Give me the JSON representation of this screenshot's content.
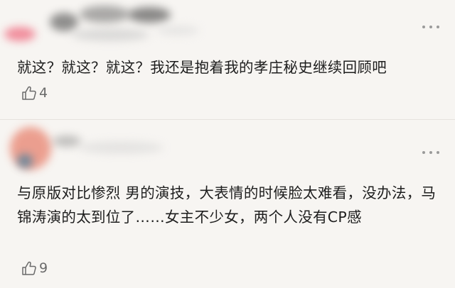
{
  "comments": [
    {
      "text": "就这？就这？就这？我还是抱着我的孝庄秘史继续回顾吧",
      "likes": "4",
      "like_icon": "thumbs-up-icon",
      "more_icon": "more-dots-icon"
    },
    {
      "text": "与原版对比惨烈 男的演技，大表情的时候脸太难看，没办法，马锦涛演的太到位了……女主不少女，两个人没有CP感",
      "likes": "9",
      "like_icon": "thumbs-up-icon",
      "more_icon": "more-dots-icon"
    }
  ],
  "colors": {
    "background": "#f7f5f2",
    "text": "#1e1e1e",
    "muted": "#6a6a6a",
    "divider": "#e6e2de"
  }
}
